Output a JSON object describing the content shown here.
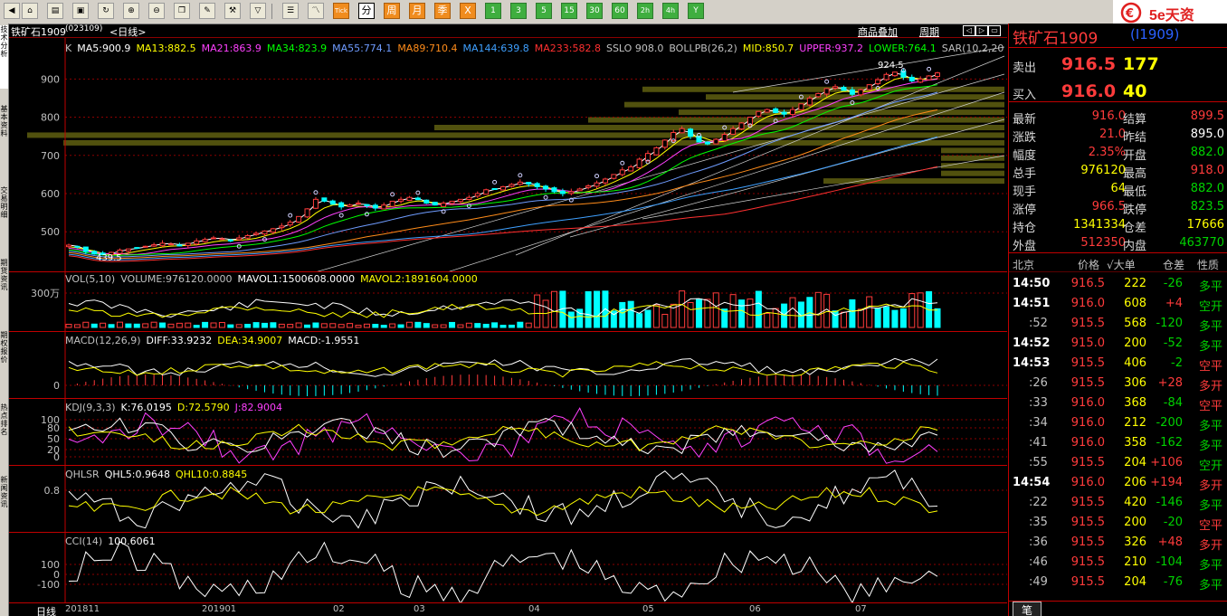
{
  "toolbar": {
    "period_buttons": [
      "分",
      "周",
      "月",
      "季",
      "X"
    ],
    "minute_buttons": [
      "1",
      "3",
      "5",
      "15",
      "30",
      "60",
      "2h",
      "4h",
      "Y"
    ],
    "tick_label": "Tick"
  },
  "brand": {
    "text": "5e天资"
  },
  "left_tabs": [
    "技术分析",
    "基本资料",
    "交易明细",
    "期货资讯",
    "期权报价",
    "热点排名",
    "新闻资讯"
  ],
  "chart_header": {
    "symbol": "铁矿石1909",
    "code": "(023109)",
    "period": "<日线>",
    "links": [
      "商品叠加",
      "周期"
    ]
  },
  "main_panel": {
    "indicators": [
      {
        "text": "K",
        "color": "#c0c0c0"
      },
      {
        "text": "MA5:900.9",
        "color": "#ffffff"
      },
      {
        "text": "MA13:882.5",
        "color": "#ffff00"
      },
      {
        "text": "MA21:863.9",
        "color": "#ff40ff"
      },
      {
        "text": "MA34:823.9",
        "color": "#00ff00"
      },
      {
        "text": "MA55:774.1",
        "color": "#6f9cff"
      },
      {
        "text": "MA89:710.4",
        "color": "#ff8c1a"
      },
      {
        "text": "MA144:639.8",
        "color": "#3fa0ff"
      },
      {
        "text": "MA233:582.8",
        "color": "#ff3030"
      },
      {
        "text": "SSLO 908.0",
        "color": "#c0c0c0"
      },
      {
        "text": "BOLLPB(26,2)",
        "color": "#c0c0c0"
      },
      {
        "text": "MID:850.7",
        "color": "#ffff00"
      },
      {
        "text": "UPPER:937.2",
        "color": "#ff40ff"
      },
      {
        "text": "LOWER:764.1",
        "color": "#00ff00"
      },
      {
        "text": "SAR(10,2,20",
        "color": "#c0c0c0"
      }
    ],
    "y_ticks": [
      "900",
      "800",
      "700",
      "600",
      "500"
    ],
    "high_label": "924.5",
    "low_label": "439.5"
  },
  "chart_data": [
    {
      "type": "line",
      "title": "铁矿石1909 <日线>",
      "xlabel": "",
      "ylabel": "",
      "x_ticks": [
        "201811",
        "201901",
        "02",
        "03",
        "04",
        "05",
        "06",
        "07"
      ],
      "ylim": [
        420,
        960
      ],
      "y_ticks": [
        500,
        600,
        700,
        800,
        900
      ],
      "high": 924.5,
      "low": 439.5,
      "close_series": [
        465,
        460,
        448,
        442,
        440,
        446,
        452,
        455,
        458,
        462,
        466,
        470,
        468,
        465,
        470,
        476,
        480,
        484,
        482,
        478,
        484,
        490,
        496,
        502,
        508,
        515,
        525,
        540,
        560,
        585,
        580,
        572,
        565,
        570,
        575,
        568,
        562,
        570,
        580,
        585,
        590,
        584,
        575,
        570,
        575,
        580,
        585,
        590,
        600,
        610,
        612,
        618,
        624,
        630,
        625,
        618,
        612,
        605,
        600,
        605,
        612,
        620,
        628,
        638,
        650,
        662,
        670,
        690,
        705,
        720,
        740,
        760,
        770,
        750,
        735,
        730,
        742,
        755,
        770,
        785,
        800,
        815,
        820,
        812,
        808,
        820,
        835,
        850,
        862,
        875,
        880,
        870,
        860,
        872,
        885,
        898,
        912,
        918,
        905,
        895,
        900,
        908,
        916
      ]
    },
    {
      "type": "bar",
      "title": "VOL(5,10)",
      "series": [
        {
          "name": "VOLUME",
          "values": [
            976120.0
          ]
        },
        {
          "name": "MAVOL1",
          "values": [
            1500608.0
          ]
        },
        {
          "name": "MAVOL2",
          "values": [
            1891604.0
          ]
        }
      ],
      "y_ticks": [
        "300万"
      ]
    },
    {
      "type": "line",
      "title": "MACD(12,26,9)",
      "series": [
        {
          "name": "DIFF",
          "values": [
            33.9232
          ]
        },
        {
          "name": "DEA",
          "values": [
            34.9007
          ]
        },
        {
          "name": "MACD",
          "values": [
            -1.9551
          ]
        }
      ],
      "y_ticks": [
        0
      ]
    },
    {
      "type": "line",
      "title": "KDJ(9,3,3)",
      "series": [
        {
          "name": "K",
          "values": [
            76.0195
          ]
        },
        {
          "name": "D",
          "values": [
            72.579
          ]
        },
        {
          "name": "J",
          "values": [
            82.9004
          ]
        }
      ],
      "y_ticks": [
        100,
        80,
        50,
        20,
        0
      ]
    },
    {
      "type": "line",
      "title": "QHLSR",
      "series": [
        {
          "name": "QHL5",
          "values": [
            0.9648
          ]
        },
        {
          "name": "QHL10",
          "values": [
            0.8845
          ]
        }
      ],
      "y_ticks": [
        0.8
      ]
    },
    {
      "type": "line",
      "title": "CCI(14)",
      "series": [
        {
          "name": "CCI",
          "values": [
            100.6061
          ]
        }
      ],
      "y_ticks": [
        100,
        0,
        -100
      ]
    }
  ],
  "sub_panels": {
    "vol": {
      "title": "VOL(5,10)",
      "items": [
        {
          "text": "VOLUME:976120.0000",
          "color": "#c0c0c0"
        },
        {
          "text": "MAVOL1:1500608.0000",
          "color": "#ffffff"
        },
        {
          "text": "MAVOL2:1891604.0000",
          "color": "#ffff00"
        }
      ],
      "tick": "300万"
    },
    "macd": {
      "title": "MACD(12,26,9)",
      "items": [
        {
          "text": "DIFF:33.9232",
          "color": "#ffffff"
        },
        {
          "text": "DEA:34.9007",
          "color": "#ffff00"
        },
        {
          "text": "MACD:-1.9551",
          "color": "#ffffff"
        }
      ],
      "tick": "0"
    },
    "kdj": {
      "title": "KDJ(9,3,3)",
      "items": [
        {
          "text": "K:76.0195",
          "color": "#ffffff"
        },
        {
          "text": "D:72.5790",
          "color": "#ffff00"
        },
        {
          "text": "J:82.9004",
          "color": "#ff40ff"
        }
      ],
      "ticks": [
        "100",
        "80",
        "50",
        "20",
        "0"
      ]
    },
    "qhlsr": {
      "title": "QHLSR",
      "items": [
        {
          "text": "QHL5:0.9648",
          "color": "#ffffff"
        },
        {
          "text": "QHL10:0.8845",
          "color": "#ffff00"
        }
      ],
      "tick": "0.8"
    },
    "cci": {
      "title": "CCI(14)",
      "items": [
        {
          "text": "100.6061",
          "color": "#ffffff"
        }
      ],
      "ticks": [
        "100",
        "0",
        "-100"
      ]
    }
  },
  "x_axis": {
    "period_label": "日线",
    "labels": [
      "201811",
      "201901",
      "02",
      "03",
      "04",
      "05",
      "06",
      "07"
    ]
  },
  "quote": {
    "name": "铁矿石1909",
    "code": "(I1909)",
    "ask_label": "卖出",
    "ask_price": "916.5",
    "ask_vol": "177",
    "bid_label": "买入",
    "bid_price": "916.0",
    "bid_vol": "40",
    "rows": [
      {
        "l1": "最新",
        "v1": "916.0",
        "c1": "#ff3b3b",
        "l2": "结算",
        "v2": "899.5",
        "c2": "#ff3b3b"
      },
      {
        "l1": "涨跌",
        "v1": "21.0",
        "c1": "#ff3b3b",
        "l2": "昨结",
        "v2": "895.0",
        "c2": "#ffffff"
      },
      {
        "l1": "幅度",
        "v1": "2.35%",
        "c1": "#ff3b3b",
        "l2": "开盘",
        "v2": "882.0",
        "c2": "#00d200"
      },
      {
        "l1": "总手",
        "v1": "976120",
        "c1": "#ffff00",
        "l2": "最高",
        "v2": "918.0",
        "c2": "#ff3b3b"
      },
      {
        "l1": "现手",
        "v1": "64",
        "c1": "#ffff00",
        "l2": "最低",
        "v2": "882.0",
        "c2": "#00d200"
      },
      {
        "l1": "涨停",
        "v1": "966.5",
        "c1": "#ff3b3b",
        "l2": "跌停",
        "v2": "823.5",
        "c2": "#00d200"
      },
      {
        "l1": "持仓",
        "v1": "1341334",
        "c1": "#ffff00",
        "l2": "仓差",
        "v2": "17666",
        "c2": "#ffff00"
      },
      {
        "l1": "外盘",
        "v1": "512350",
        "c1": "#ff3b3b",
        "l2": "内盘",
        "v2": "463770",
        "c2": "#00d200"
      }
    ],
    "tick_header": {
      "time": "北京",
      "price": "价格",
      "vol": "√大单",
      "oi": "仓差",
      "nature": "性质"
    },
    "ticks": [
      {
        "t": "14:50",
        "p": "916.5",
        "v": "222",
        "d": "-26",
        "n": "多平",
        "tc": "#ffffff",
        "pc": "#ff3b3b",
        "dc": "#00d200",
        "nc": "#00d200"
      },
      {
        "t": "14:51",
        "p": "916.0",
        "v": "608",
        "d": "+4",
        "n": "空开",
        "tc": "#ffffff",
        "pc": "#ff3b3b",
        "dc": "#ff3b3b",
        "nc": "#00d200"
      },
      {
        "t": ":52",
        "p": "915.5",
        "v": "568",
        "d": "-120",
        "n": "多平",
        "tc": "#c0c0c0",
        "pc": "#ff3b3b",
        "dc": "#00d200",
        "nc": "#00d200"
      },
      {
        "t": "14:52",
        "p": "915.0",
        "v": "200",
        "d": "-52",
        "n": "多平",
        "tc": "#ffffff",
        "pc": "#ff3b3b",
        "dc": "#00d200",
        "nc": "#00d200"
      },
      {
        "t": "14:53",
        "p": "915.5",
        "v": "406",
        "d": "-2",
        "n": "空平",
        "tc": "#ffffff",
        "pc": "#ff3b3b",
        "dc": "#00d200",
        "nc": "#ff3b3b"
      },
      {
        "t": ":26",
        "p": "915.5",
        "v": "306",
        "d": "+28",
        "n": "多开",
        "tc": "#c0c0c0",
        "pc": "#ff3b3b",
        "dc": "#ff3b3b",
        "nc": "#ff3b3b"
      },
      {
        "t": ":33",
        "p": "916.0",
        "v": "368",
        "d": "-84",
        "n": "空平",
        "tc": "#c0c0c0",
        "pc": "#ff3b3b",
        "dc": "#00d200",
        "nc": "#ff3b3b"
      },
      {
        "t": ":34",
        "p": "916.0",
        "v": "212",
        "d": "-200",
        "n": "多平",
        "tc": "#c0c0c0",
        "pc": "#ff3b3b",
        "dc": "#00d200",
        "nc": "#00d200"
      },
      {
        "t": ":41",
        "p": "916.0",
        "v": "358",
        "d": "-162",
        "n": "多平",
        "tc": "#c0c0c0",
        "pc": "#ff3b3b",
        "dc": "#00d200",
        "nc": "#00d200"
      },
      {
        "t": ":55",
        "p": "915.5",
        "v": "204",
        "d": "+106",
        "n": "空开",
        "tc": "#c0c0c0",
        "pc": "#ff3b3b",
        "dc": "#ff3b3b",
        "nc": "#00d200"
      },
      {
        "t": "14:54",
        "p": "916.0",
        "v": "206",
        "d": "+194",
        "n": "多开",
        "tc": "#ffffff",
        "pc": "#ff3b3b",
        "dc": "#ff3b3b",
        "nc": "#ff3b3b"
      },
      {
        "t": ":22",
        "p": "915.5",
        "v": "420",
        "d": "-146",
        "n": "多平",
        "tc": "#c0c0c0",
        "pc": "#ff3b3b",
        "dc": "#00d200",
        "nc": "#00d200"
      },
      {
        "t": ":35",
        "p": "915.5",
        "v": "200",
        "d": "-20",
        "n": "空平",
        "tc": "#c0c0c0",
        "pc": "#ff3b3b",
        "dc": "#00d200",
        "nc": "#ff3b3b"
      },
      {
        "t": ":36",
        "p": "915.5",
        "v": "326",
        "d": "+48",
        "n": "多开",
        "tc": "#c0c0c0",
        "pc": "#ff3b3b",
        "dc": "#ff3b3b",
        "nc": "#ff3b3b"
      },
      {
        "t": ":46",
        "p": "915.5",
        "v": "210",
        "d": "-104",
        "n": "多平",
        "tc": "#c0c0c0",
        "pc": "#ff3b3b",
        "dc": "#00d200",
        "nc": "#00d200"
      },
      {
        "t": ":49",
        "p": "915.5",
        "v": "204",
        "d": "-76",
        "n": "多平",
        "tc": "#c0c0c0",
        "pc": "#ff3b3b",
        "dc": "#00d200",
        "nc": "#00d200"
      }
    ],
    "bottom_tab": "笔"
  },
  "colors": {
    "up": "#ff3b3b",
    "down": "#00d200",
    "grid": "#8b0000",
    "accent": "#c00000"
  }
}
